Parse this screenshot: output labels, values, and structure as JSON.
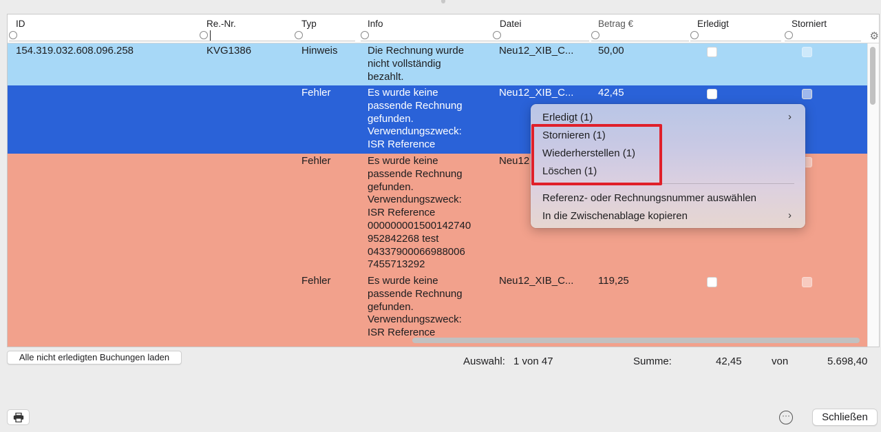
{
  "columns": [
    {
      "title": "ID"
    },
    {
      "title": "Re.-Nr."
    },
    {
      "title": "Typ"
    },
    {
      "title": "Info"
    },
    {
      "title": "Datei"
    },
    {
      "title": "Betrag €"
    },
    {
      "title": "Erledigt"
    },
    {
      "title": "Storniert"
    }
  ],
  "rows": [
    {
      "id": "154.319.032.608.096.258",
      "re_nr": "KVG1386",
      "typ": "Hinweis",
      "info": [
        "Die Rechnung wurde",
        "nicht vollständig",
        "bezahlt."
      ],
      "datei": "Neu12_XIB_C...",
      "betrag": "50,00",
      "erledigt": false,
      "storniert": false
    },
    {
      "id": "",
      "re_nr": "",
      "typ": "Fehler",
      "info": [
        "Es wurde keine",
        "passende Rechnung",
        "gefunden.",
        "Verwendungszweck:",
        "ISR Reference"
      ],
      "datei": "Neu12_XIB_C...",
      "betrag": "42,45",
      "erledigt": false,
      "storniert": false
    },
    {
      "id": "",
      "re_nr": "",
      "typ": "Fehler",
      "info": [
        "Es wurde keine",
        "passende Rechnung",
        "gefunden.",
        "Verwendungszweck:",
        "ISR Reference",
        "000000001500142740",
        "952842268 test",
        "04337900066988006",
        "7455713292"
      ],
      "datei": "Neu12",
      "betrag": "",
      "erledigt": false,
      "storniert": false
    },
    {
      "id": "",
      "re_nr": "",
      "typ": "Fehler",
      "info": [
        "Es wurde keine",
        "passende Rechnung",
        "gefunden.",
        "Verwendungszweck:",
        "ISR Reference"
      ],
      "datei": "Neu12_XIB_C...",
      "betrag": "119,25",
      "erledigt": false,
      "storniert": false
    }
  ],
  "context_menu": {
    "items": [
      {
        "label": "Erledigt (1)",
        "submenu_arrow": "›"
      },
      {
        "label": "Stornieren (1)"
      },
      {
        "label": "Wiederherstellen (1)"
      },
      {
        "label": "Löschen (1)"
      },
      {
        "label": "Referenz- oder Rechnungsnummer auswählen"
      },
      {
        "label": "In die Zwischenablage kopieren",
        "submenu_arrow": "›"
      }
    ],
    "highlight_color": "#e0202a"
  },
  "footer": {
    "load_button": "Alle nicht erledigten Buchungen laden",
    "selection_label": "Auswahl:",
    "selection_value": "1 von 47",
    "sum_label": "Summe:",
    "sum_value": "42,45",
    "of_label": "von",
    "total_value": "5.698,40"
  },
  "bottom": {
    "print_icon": "printer-icon",
    "more_icon": "ellipsis-circle-icon",
    "close_button": "Schließen"
  },
  "header_gear_icon": "gear-icon",
  "colors": {
    "row_light_blue": "#a7d8f7",
    "row_selected": "#2a62d8",
    "row_salmon": "#f2a18c"
  }
}
